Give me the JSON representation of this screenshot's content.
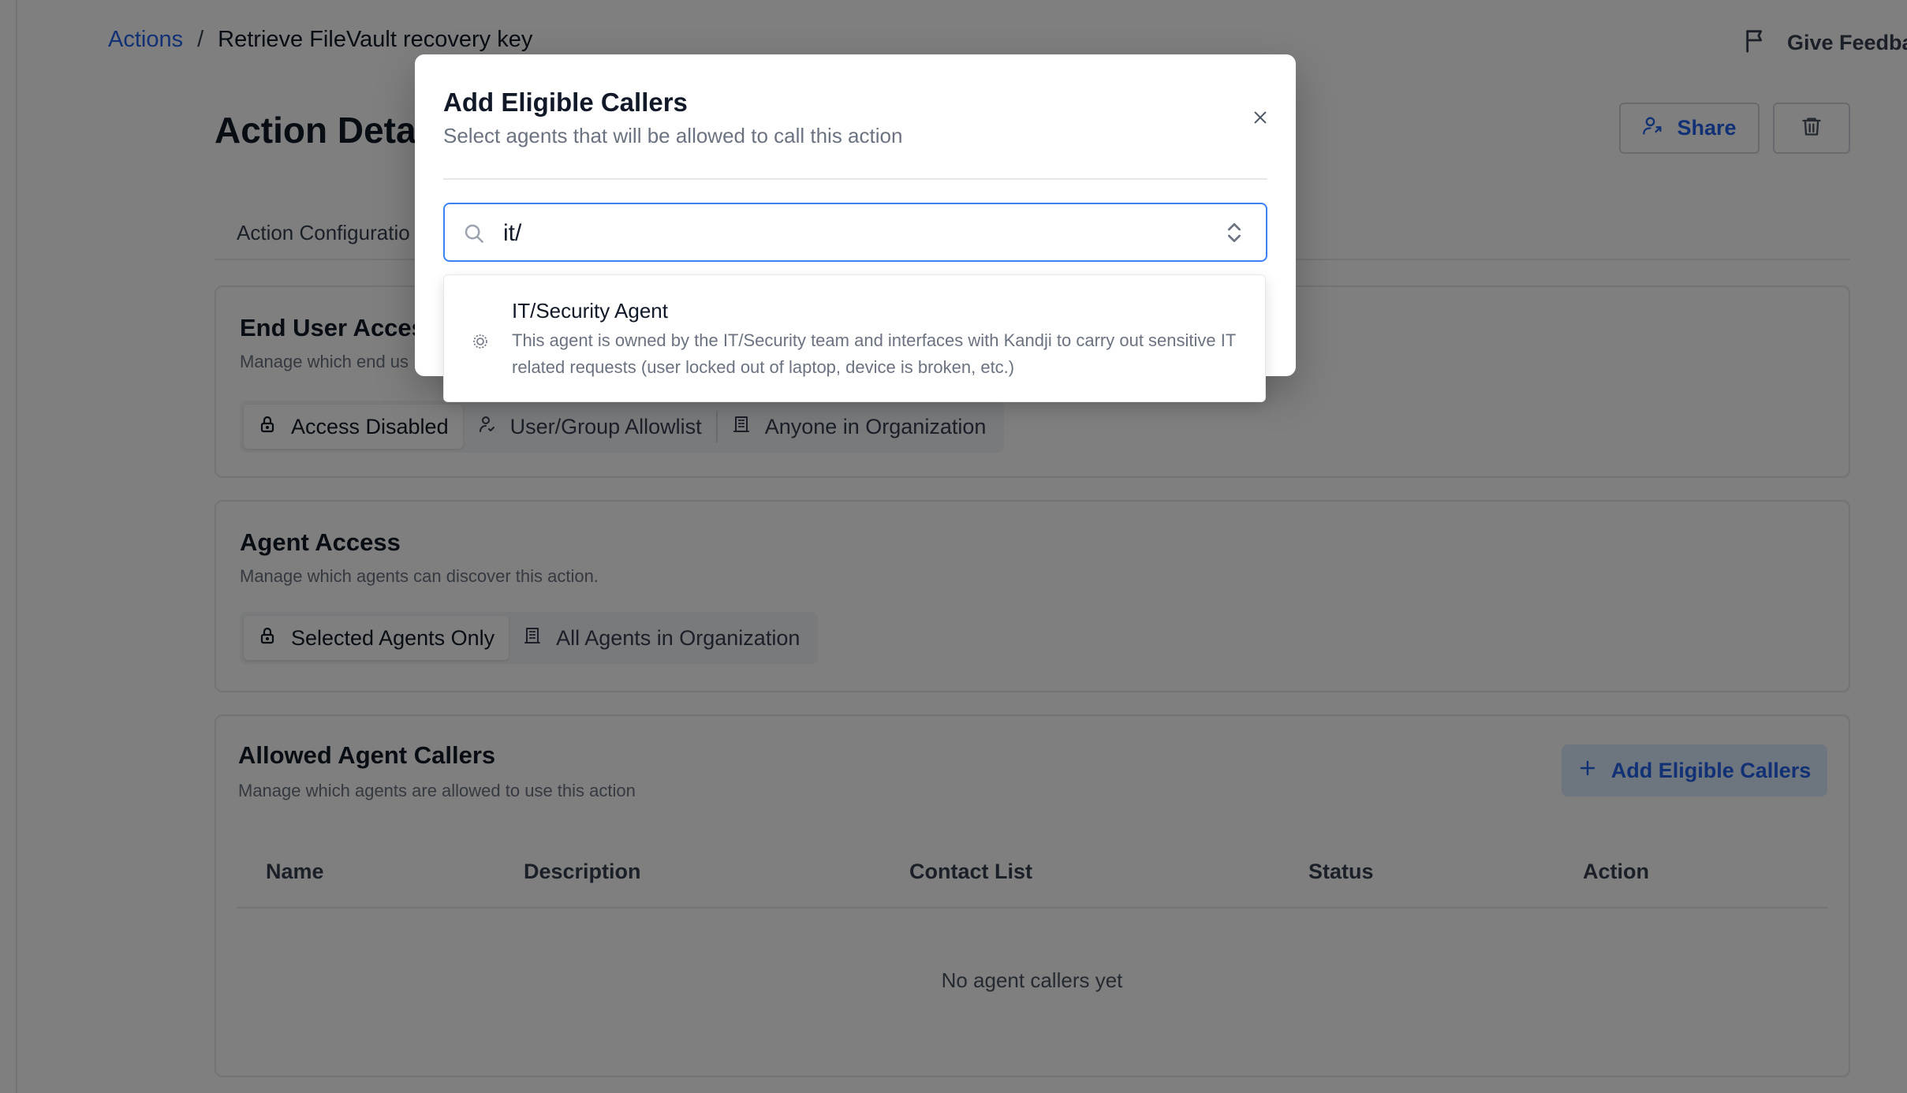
{
  "breadcrumb": {
    "root": "Actions",
    "separator": "/",
    "current": "Retrieve FileVault recovery key"
  },
  "header": {
    "feedback_label": "Give Feedba",
    "title": "Action Detail",
    "share_label": "Share"
  },
  "tabs": [
    {
      "label": "Action Configuratio"
    }
  ],
  "end_user_access": {
    "title": "End User Access",
    "subtitle": "Manage which end us",
    "options": [
      "Access Disabled",
      "User/Group Allowlist",
      "Anyone in Organization"
    ],
    "selected": "Access Disabled"
  },
  "agent_access": {
    "title": "Agent Access",
    "subtitle": "Manage which agents can discover this action.",
    "options": [
      "Selected Agents Only",
      "All Agents in Organization"
    ],
    "selected": "Selected Agents Only"
  },
  "allowed_callers": {
    "title": "Allowed Agent Callers",
    "subtitle": "Manage which agents are allowed to use this action",
    "add_button": "Add Eligible Callers",
    "columns": [
      "Name",
      "Description",
      "Contact List",
      "Status",
      "Action"
    ],
    "empty_message": "No agent callers yet"
  },
  "modal": {
    "title": "Add Eligible Callers",
    "subtitle": "Select agents that will be allowed to call this action",
    "search_value": "it/",
    "results": [
      {
        "name": "IT/Security Agent",
        "description": "This agent is owned by the IT/Security team and interfaces with Kandji to carry out sensitive IT related requests (user locked out of laptop, device is broken, etc.)"
      }
    ]
  },
  "colors": {
    "accent": "#2563eb",
    "focus": "#3b82f6",
    "overlay": "rgba(0,0,0,0.5)"
  },
  "icons": [
    "flag-icon",
    "share-user-icon",
    "trash-icon",
    "lock-icon",
    "user-icon",
    "building-icon",
    "plus-icon",
    "close-icon",
    "search-icon",
    "chevron-updown-icon",
    "agent-gear-icon"
  ]
}
